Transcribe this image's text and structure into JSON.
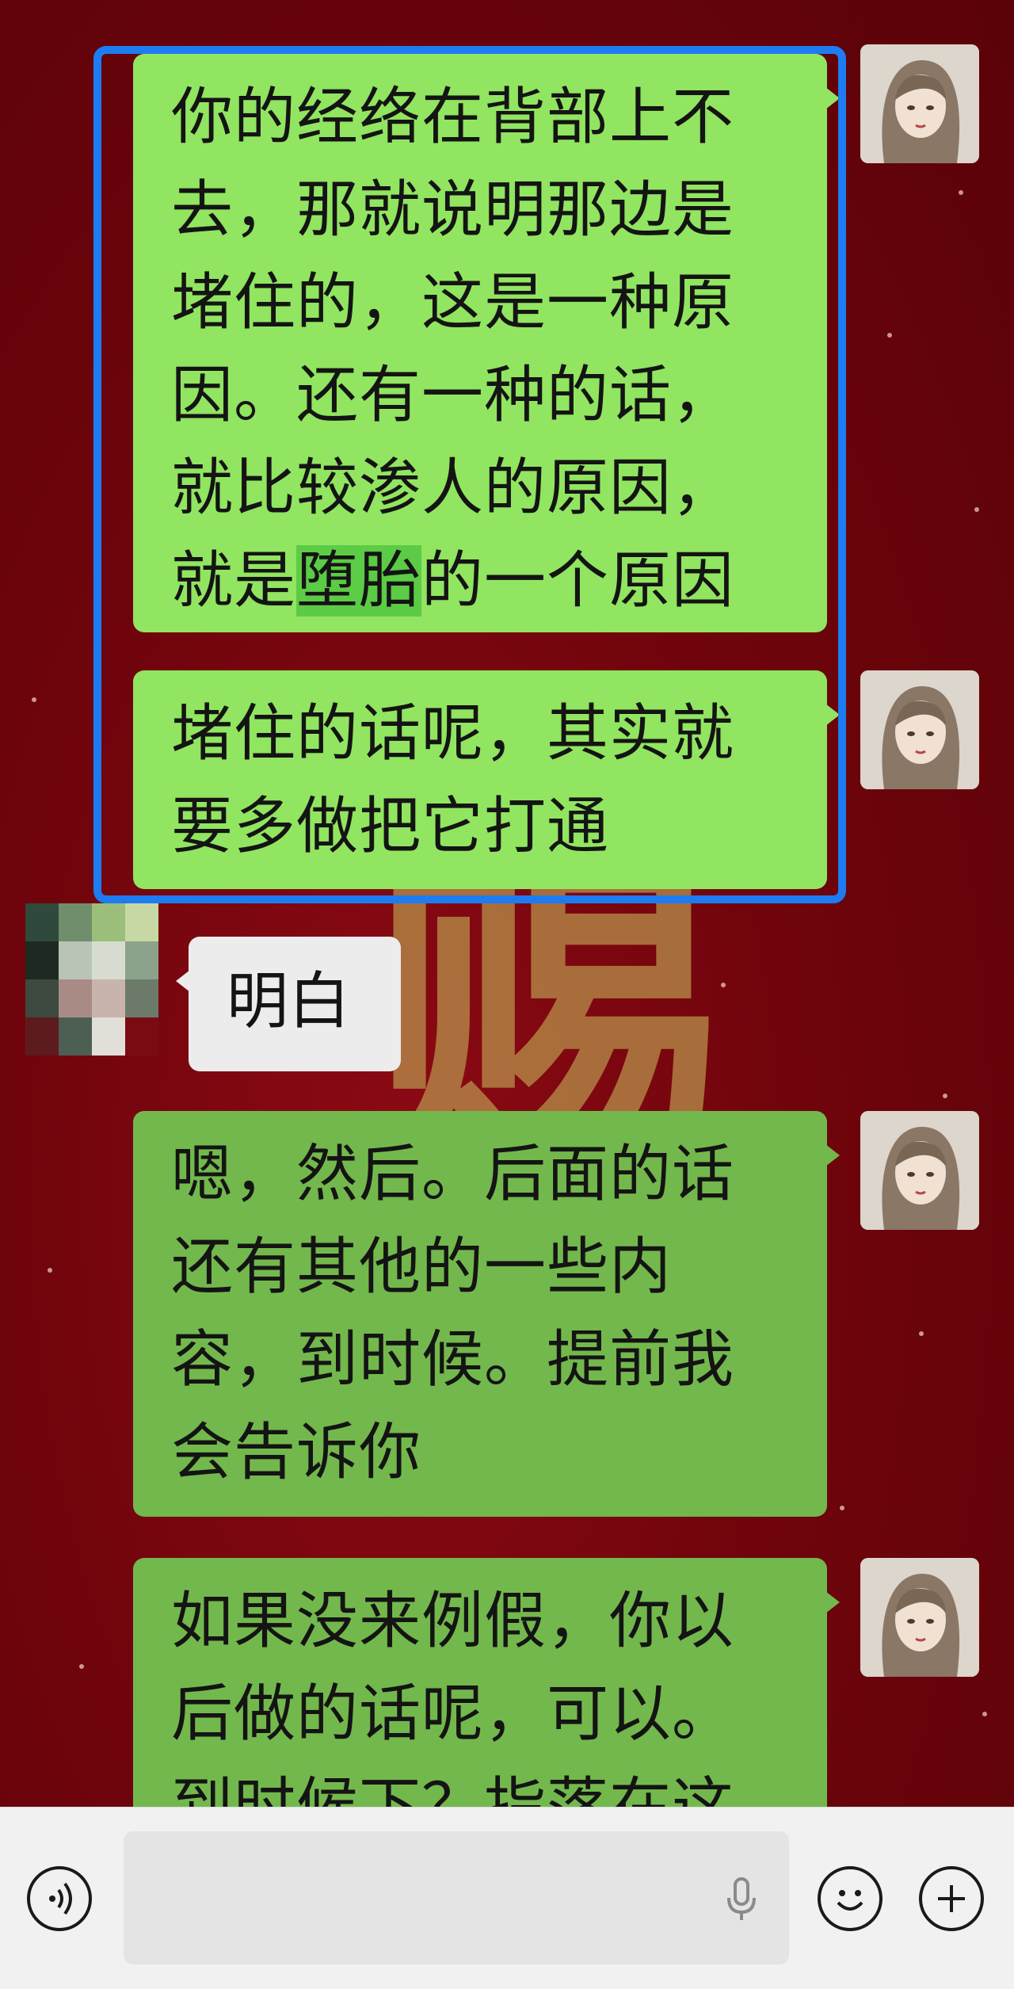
{
  "messages": [
    {
      "side": "right",
      "text_before": "你的经络在背部上不去，那就说明那边是堵住的，这是一种原因。还有一种的话，就比较渗人的原因，就是",
      "highlight": "堕胎",
      "text_after": "的一个原因"
    },
    {
      "side": "right",
      "text": "堵住的话呢，其实就要多做把它打通"
    },
    {
      "side": "left",
      "text": "明白"
    },
    {
      "side": "right",
      "text": "嗯，然后。后面的话还有其他的一些内容，到时候。提前我会告诉你"
    },
    {
      "side": "right",
      "text": "如果没来例假，你以后做的话呢，可以。到时候下？指落在这"
    }
  ],
  "background_glyph": "赐",
  "composer": {
    "voice_icon": "voice-icon",
    "mic_icon": "mic-icon",
    "emoji_icon": "emoji-icon",
    "plus_icon": "plus-icon",
    "placeholder": ""
  },
  "colors": {
    "bubble_out": "#91e560",
    "bubble_out_dim": "#73b84c",
    "bubble_in": "#ececec",
    "highlight": "#5ccb45",
    "selection_frame": "#1d7cf2",
    "background": "#70040c"
  }
}
